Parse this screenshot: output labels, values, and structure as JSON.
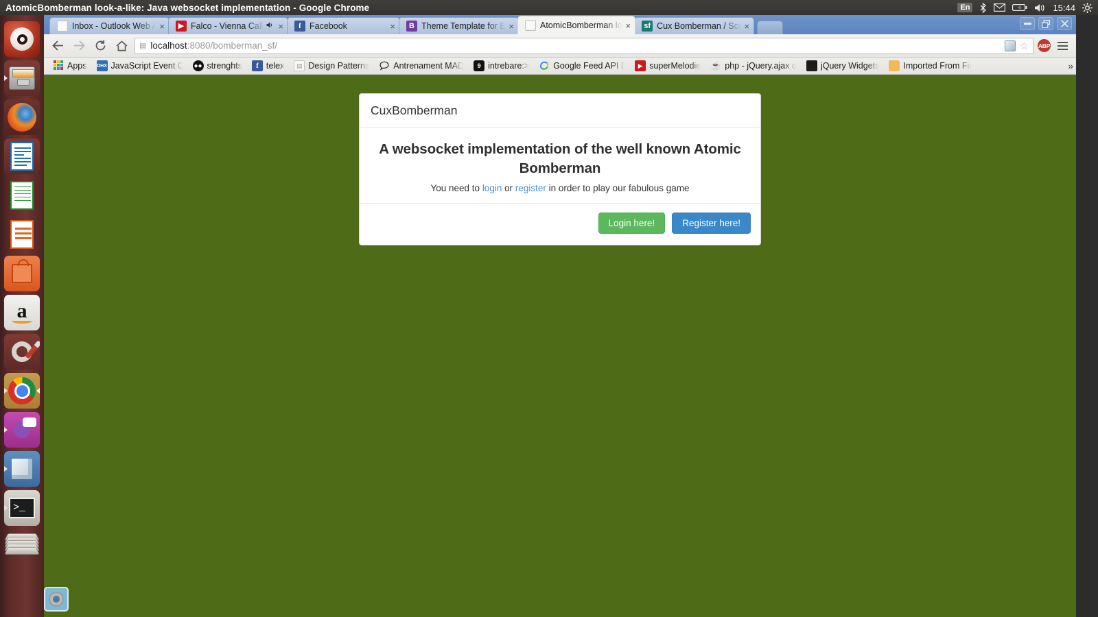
{
  "desktop": {
    "window_title": "AtomicBomberman look-a-like: Java websocket implementation - Google Chrome",
    "tray": {
      "language": "En",
      "bluetooth_icon": "bluetooth-icon",
      "mail_icon": "mail-icon",
      "battery_icon": "battery-icon",
      "volume_icon": "volume-icon",
      "clock": "15:44",
      "gear_icon": "system-settings-icon"
    },
    "launcher": {
      "items": [
        {
          "name": "ubuntu-dash",
          "label": "Ubuntu Dash"
        },
        {
          "name": "files",
          "label": "Files"
        },
        {
          "name": "firefox",
          "label": "Firefox"
        },
        {
          "name": "libreoffice-writer",
          "label": "LibreOffice Writer"
        },
        {
          "name": "libreoffice-calc",
          "label": "LibreOffice Calc"
        },
        {
          "name": "libreoffice-impress",
          "label": "LibreOffice Impress"
        },
        {
          "name": "ubuntu-software-center",
          "label": "Ubuntu Software Center"
        },
        {
          "name": "amazon",
          "label": "Amazon"
        },
        {
          "name": "system-settings",
          "label": "System Settings"
        },
        {
          "name": "google-chrome",
          "label": "Google Chrome"
        },
        {
          "name": "pidgin",
          "label": "Pidgin"
        },
        {
          "name": "virtualbox",
          "label": "VirtualBox"
        },
        {
          "name": "terminal",
          "label": "Terminal"
        },
        {
          "name": "workspace-switcher",
          "label": "Workspace Switcher"
        }
      ],
      "bottom_gear_label": "Settings"
    },
    "window_controls": {
      "minimize": "–",
      "restore": "❐",
      "close": "✕"
    }
  },
  "browser": {
    "tabs": [
      {
        "title": "Inbox - Outlook Web A",
        "favicon": "page-icon",
        "active": false,
        "muted": false
      },
      {
        "title": "Falco - Vienna Callin",
        "favicon": "youtube-icon",
        "active": false,
        "muted": true
      },
      {
        "title": "Facebook",
        "favicon": "facebook-icon",
        "active": false,
        "muted": false
      },
      {
        "title": "Theme Template for B",
        "favicon": "bootstrap-icon",
        "active": false,
        "muted": false
      },
      {
        "title": "AtomicBomberman lo",
        "favicon": "page-icon",
        "active": true,
        "muted": false
      },
      {
        "title": "Cux Bomberman / Scre",
        "favicon": "sourceforge-icon",
        "active": false,
        "muted": false
      }
    ],
    "tab_close_label": "×",
    "tab_mute_label": "🔇",
    "new_tab_label": "",
    "toolbar": {
      "back_icon": "back-arrow-icon",
      "forward_icon": "forward-arrow-icon",
      "reload_icon": "reload-icon",
      "home_icon": "home-icon",
      "url_host": "localhost",
      "url_rest": ":8080/bomberman_sf/",
      "page_icon": "page-info-icon",
      "cube_icon": "extension-cube-icon",
      "star_icon": "bookmark-star-icon",
      "abp_label": "ABP",
      "menu_icon": "chrome-menu-icon"
    },
    "bookmarks": [
      {
        "label": "Apps",
        "icon": "apps-grid-icon"
      },
      {
        "label": "JavaScript Event C",
        "icon": "dhx-icon"
      },
      {
        "label": "strenghts",
        "icon": "smiley-icon"
      },
      {
        "label": "telex",
        "icon": "facebook-icon"
      },
      {
        "label": "Design Patterns",
        "icon": "page-icon"
      },
      {
        "label": "Antrenament MAD",
        "icon": "chat-bubble-icon"
      },
      {
        "label": "intrebare:>",
        "icon": "nine-badge-icon"
      },
      {
        "label": "Google Feed API D",
        "icon": "google-icon"
      },
      {
        "label": "superMelodie",
        "icon": "youtube-icon"
      },
      {
        "label": "php - jQuery.ajax o",
        "icon": "java-icon"
      },
      {
        "label": "jQuery Widgets",
        "icon": "dark-square-icon"
      },
      {
        "label": "Imported From Fir",
        "icon": "folder-icon"
      }
    ],
    "bookmarks_overflow": "»"
  },
  "page": {
    "brand": "CuxBomberman",
    "heading": "A websocket implementation of the well known Atomic Bomberman",
    "sub_prefix": "You need to ",
    "sub_login": "login",
    "sub_middle": " or ",
    "sub_register": "register",
    "sub_suffix": " in order to play our fabulous game",
    "login_button": "Login here!",
    "register_button": "Register here!",
    "background_color": "#4e6b17",
    "login_color": "#5cb85c",
    "register_color": "#3b88c8",
    "link_color": "#4a90d9"
  }
}
